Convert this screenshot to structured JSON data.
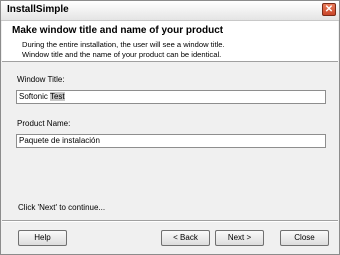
{
  "window": {
    "title": "InstallSimple"
  },
  "header": {
    "title": "Make window title and name of your product",
    "desc_line1": "During the entire installation, the user will see a window title.",
    "desc_line2": "Window title and the name of your product can be identical."
  },
  "fields": {
    "window_title": {
      "label": "Window Title:",
      "value_plain": "Softonic ",
      "value_selected": "Test"
    },
    "product_name": {
      "label": "Product Name:",
      "value": "Paquete de instalación"
    }
  },
  "status": "Click 'Next' to continue...",
  "buttons": {
    "help": "Help",
    "back": "< Back",
    "next": "Next >",
    "close": "Close"
  },
  "icons": {
    "close": "close-icon"
  }
}
